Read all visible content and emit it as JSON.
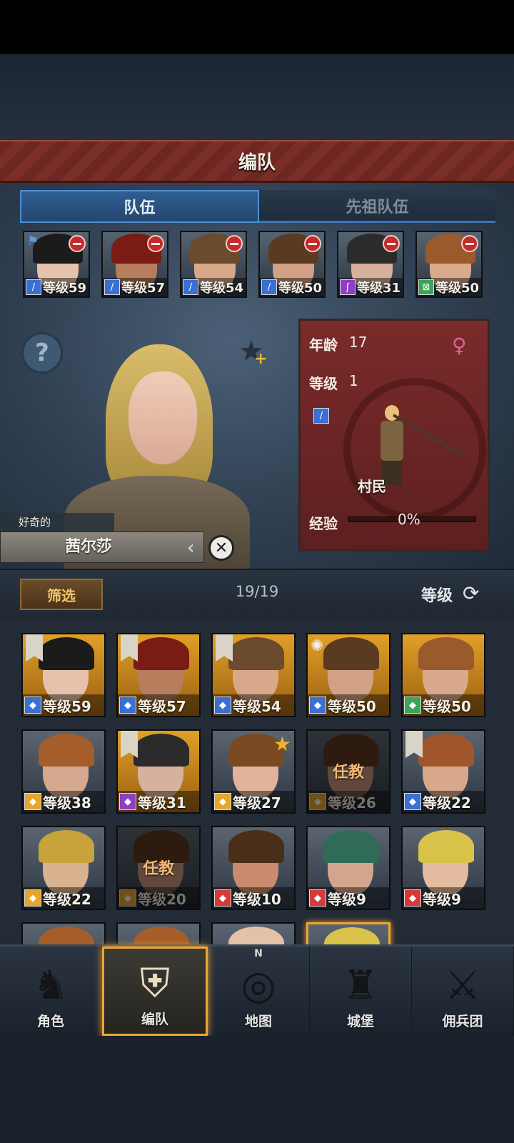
{
  "screen": {
    "title": "编队"
  },
  "tabs": [
    {
      "label": "队伍",
      "active": true
    },
    {
      "label": "先祖队伍",
      "active": false
    }
  ],
  "team": [
    {
      "level": "等级59",
      "class_color": "#3b6fd1",
      "class_icon": "sword-icon",
      "skin": "#e6c2ac",
      "hair": "#1b1b1b",
      "flag": true
    },
    {
      "level": "等级57",
      "class_color": "#3b6fd1",
      "class_icon": "sword-icon",
      "skin": "#b77e5e",
      "hair": "#7a1b14"
    },
    {
      "level": "等级54",
      "class_color": "#3b6fd1",
      "class_icon": "sword-icon",
      "skin": "#d8a88a",
      "hair": "#6b4a2e"
    },
    {
      "level": "等级50",
      "class_color": "#3b6fd1",
      "class_icon": "sword-icon",
      "skin": "#d0a184",
      "hair": "#5a3a20"
    },
    {
      "level": "等级31",
      "class_color": "#8e3fc2",
      "class_icon": "staff-icon",
      "skin": "#d6b19e",
      "hair": "#2b2b2b"
    },
    {
      "level": "等级50",
      "class_color": "#3aa556",
      "class_icon": "bow-icon",
      "skin": "#d9a98c",
      "hair": "#9a5a2c"
    }
  ],
  "character": {
    "trait": "好奇的",
    "name": "茜尔莎",
    "age_label": "年龄",
    "age": "17",
    "level_label": "等级",
    "level": "1",
    "class_name": "村民",
    "gender": "female",
    "exp_label": "经验",
    "exp_value": "0%",
    "exp_progress": 0
  },
  "filter": {
    "filter_label": "筛选",
    "count": "19/19",
    "sort_label": "等级"
  },
  "roster": [
    {
      "level": "等级59",
      "class_color": "#3b6fd1",
      "skin": "#e6c2ac",
      "hair": "#1b1b1b",
      "gold": true,
      "badge": "banner"
    },
    {
      "level": "等级57",
      "class_color": "#3b6fd1",
      "skin": "#b77e5e",
      "hair": "#7a1b14",
      "gold": true,
      "badge": "banner"
    },
    {
      "level": "等级54",
      "class_color": "#3b6fd1",
      "skin": "#d8a88a",
      "hair": "#6b4a2e",
      "gold": true,
      "badge": "banner"
    },
    {
      "level": "等级50",
      "class_color": "#3b6fd1",
      "skin": "#d0a184",
      "hair": "#5a3a20",
      "gold": true,
      "badge": "sun"
    },
    {
      "level": "等级50",
      "class_color": "#3aa556",
      "skin": "#d9a98c",
      "hair": "#9a5a2c",
      "gold": true,
      "badge": ""
    },
    {
      "level": "等级38",
      "class_color": "#e7a52a",
      "skin": "#d5a98e",
      "hair": "#a55e2a",
      "gold": false,
      "badge": ""
    },
    {
      "level": "等级31",
      "class_color": "#8e3fc2",
      "skin": "#d6b19e",
      "hair": "#2b2b2b",
      "gold": true,
      "badge": "banner"
    },
    {
      "level": "等级27",
      "class_color": "#e7a52a",
      "skin": "#e0b39a",
      "hair": "#7a4a22",
      "gold": false,
      "badge": "star"
    },
    {
      "level": "等级26",
      "class_color": "#e7a52a",
      "skin": "#c9977a",
      "hair": "#5b3218",
      "gold": false,
      "badge": "",
      "task": "任教"
    },
    {
      "level": "等级22",
      "class_color": "#3b6fd1",
      "skin": "#d8a88a",
      "hair": "#a0562a",
      "gold": false,
      "badge": "banner"
    },
    {
      "level": "等级22",
      "class_color": "#e7a52a",
      "skin": "#d9b38f",
      "hair": "#c8a23a",
      "gold": false,
      "badge": ""
    },
    {
      "level": "等级20",
      "class_color": "#e7a52a",
      "skin": "#c9977a",
      "hair": "#5b3218",
      "gold": false,
      "badge": "",
      "task": "任教"
    },
    {
      "level": "等级10",
      "class_color": "#d53a3a",
      "skin": "#c98a6e",
      "hair": "#4a2e18",
      "gold": false,
      "badge": ""
    },
    {
      "level": "等级9",
      "class_color": "#d53a3a",
      "skin": "#d2a58c",
      "hair": "#2f6b57",
      "gold": false,
      "badge": ""
    },
    {
      "level": "等级9",
      "class_color": "#d53a3a",
      "skin": "#e3bb9e",
      "hair": "#d8c24a",
      "gold": false,
      "badge": ""
    },
    {
      "level": "",
      "class_color": "#e7a52a",
      "skin": "#d5a98e",
      "hair": "#a55e2a",
      "gold": false,
      "badge": ""
    },
    {
      "level": "",
      "class_color": "#e7a52a",
      "skin": "#d5a98e",
      "hair": "#a55e2a",
      "gold": false,
      "badge": ""
    },
    {
      "level": "",
      "class_color": "#e7a52a",
      "skin": "#e3c2a8",
      "hair": "#e3c2a8",
      "gold": false,
      "badge": ""
    },
    {
      "level": "",
      "class_color": "#e7a52a",
      "skin": "#e3bb9e",
      "hair": "#d8c24a",
      "gold": false,
      "badge": "",
      "selected": true
    }
  ],
  "nav": [
    {
      "label": "角色",
      "icon": "knight-icon",
      "active": false
    },
    {
      "label": "编队",
      "icon": "helmet-icon",
      "active": true
    },
    {
      "label": "地图",
      "icon": "compass-map-icon",
      "active": false
    },
    {
      "label": "城堡",
      "icon": "castle-icon",
      "active": false
    },
    {
      "label": "佣兵团",
      "icon": "mercenary-banner-icon",
      "active": false
    }
  ],
  "compass_letter": "N"
}
